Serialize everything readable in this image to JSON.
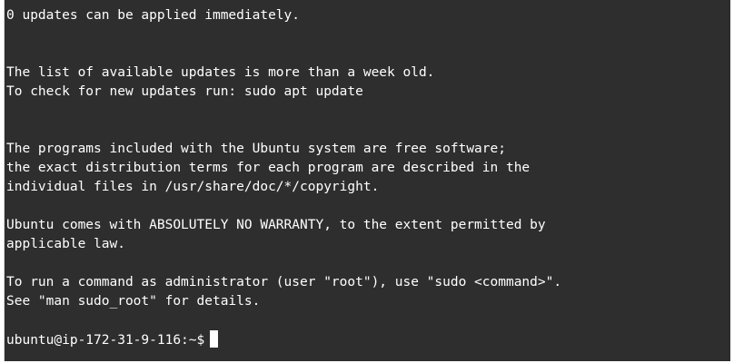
{
  "terminal": {
    "lines": [
      "0 updates can be applied immediately.",
      "",
      "",
      "The list of available updates is more than a week old.",
      "To check for new updates run: sudo apt update",
      "",
      "",
      "The programs included with the Ubuntu system are free software;",
      "the exact distribution terms for each program are described in the",
      "individual files in /usr/share/doc/*/copyright.",
      "",
      "Ubuntu comes with ABSOLUTELY NO WARRANTY, to the extent permitted by",
      "applicable law.",
      "",
      "To run a command as administrator (user \"root\"), use \"sudo <command>\".",
      "See \"man sudo_root\" for details.",
      "",
      "ubuntu@ip-172-31-9-116:~$"
    ],
    "colors": {
      "background": "#2e2e2e",
      "foreground": "#ffffff",
      "cursor": "#ffffff"
    }
  }
}
